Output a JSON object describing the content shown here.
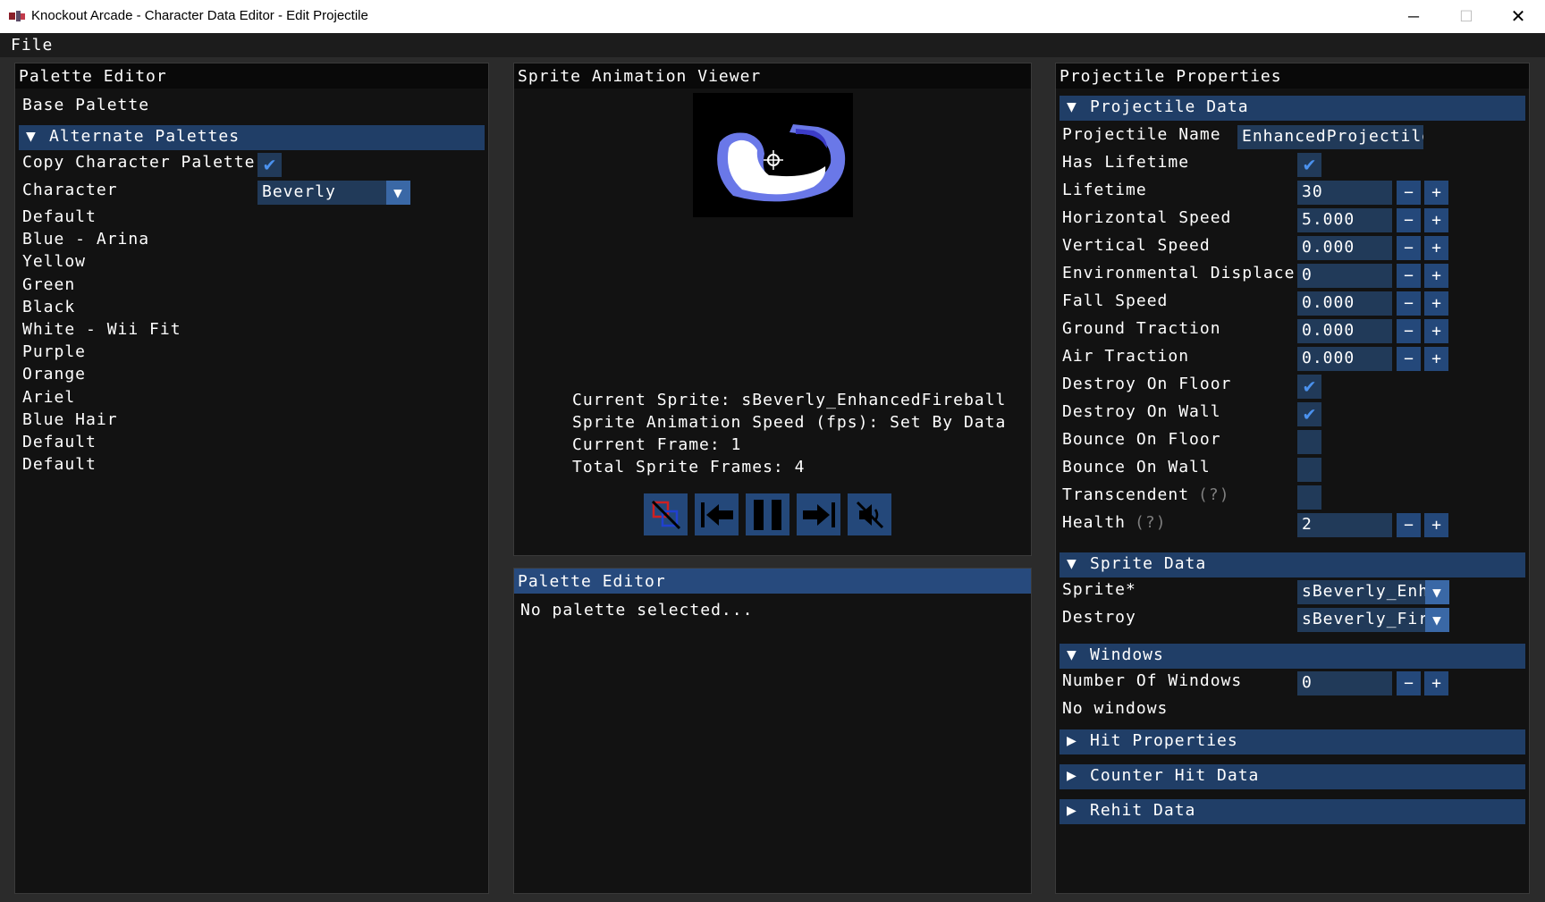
{
  "window": {
    "title": "Knockout Arcade - Character Data Editor - Edit Projectile",
    "minimize_glyph": "─",
    "maximize_glyph": "☐",
    "close_glyph": "✕"
  },
  "menu": {
    "file": "File"
  },
  "palette_panel": {
    "title": "Palette Editor",
    "base_palette": "Base Palette",
    "alternate_header": "Alternate Palettes",
    "copy_label": "Copy Character Palette",
    "copy_checked": true,
    "character_label": "Character",
    "character_value": "Beverly",
    "palettes": [
      "Default",
      "Blue - Arina",
      "Yellow",
      "Green",
      "Black",
      "White - Wii Fit",
      "Purple",
      "Orange",
      "Ariel",
      "Blue Hair",
      "Default",
      "Default"
    ]
  },
  "viewer": {
    "title": "Sprite Animation Viewer",
    "current_sprite": "Current Sprite: sBeverly_EnhancedFireball",
    "speed": "Sprite Animation Speed (fps): Set By Data",
    "current_frame": "Current Frame: 1",
    "total_frames": "Total Sprite Frames: 4",
    "controls": [
      "hitbox-toggle-icon",
      "previous-frame-icon",
      "pause-icon",
      "next-frame-icon",
      "mute-icon"
    ]
  },
  "palette_editor2": {
    "title": "Palette Editor",
    "message": "No palette selected..."
  },
  "projectile": {
    "title": "Projectile Properties",
    "data_header": "Projectile Data",
    "name_label": "Projectile Name",
    "name_value": "EnhancedProjectile",
    "rows": [
      {
        "label": "Has Lifetime",
        "type": "check",
        "checked": true
      },
      {
        "label": "Lifetime",
        "type": "num",
        "value": "30"
      },
      {
        "label": "Horizontal Speed",
        "type": "num",
        "value": "5.000"
      },
      {
        "label": "Vertical Speed",
        "type": "num",
        "value": "0.000"
      },
      {
        "label": "Environmental Displace",
        "type": "num",
        "value": "0"
      },
      {
        "label": "Fall Speed",
        "type": "num",
        "value": "0.000"
      },
      {
        "label": "Ground Traction",
        "type": "num",
        "value": "0.000"
      },
      {
        "label": "Air Traction",
        "type": "num",
        "value": "0.000"
      },
      {
        "label": "Destroy On Floor",
        "type": "check",
        "checked": true
      },
      {
        "label": "Destroy On Wall",
        "type": "check",
        "checked": true
      },
      {
        "label": "Bounce On Floor",
        "type": "check",
        "checked": false
      },
      {
        "label": "Bounce On Wall",
        "type": "check",
        "checked": false
      },
      {
        "label": "Transcendent",
        "help": "(?)",
        "type": "check",
        "checked": false
      },
      {
        "label": "Health",
        "help": "(?)",
        "type": "num",
        "value": "2"
      }
    ],
    "minus": "−",
    "plus": "+",
    "sprite_header": "Sprite Data",
    "sprite_label": "Sprite*",
    "sprite_value": "sBeverly_EnhancedFireball",
    "destroy_label": "Destroy",
    "destroy_value": "sBeverly_FireballDestroy",
    "windows_header": "Windows",
    "num_windows_label": "Number Of Windows",
    "num_windows_value": "0",
    "no_windows": "No windows",
    "hit_header": "Hit Properties",
    "counter_header": "Counter Hit Data",
    "rehit_header": "Rehit Data"
  },
  "colors": {
    "panel_bg": "#121212",
    "header_bg": "#203e67",
    "input_bg": "#213a59",
    "button_bg": "#24487a",
    "check_color": "#4b92ef"
  }
}
